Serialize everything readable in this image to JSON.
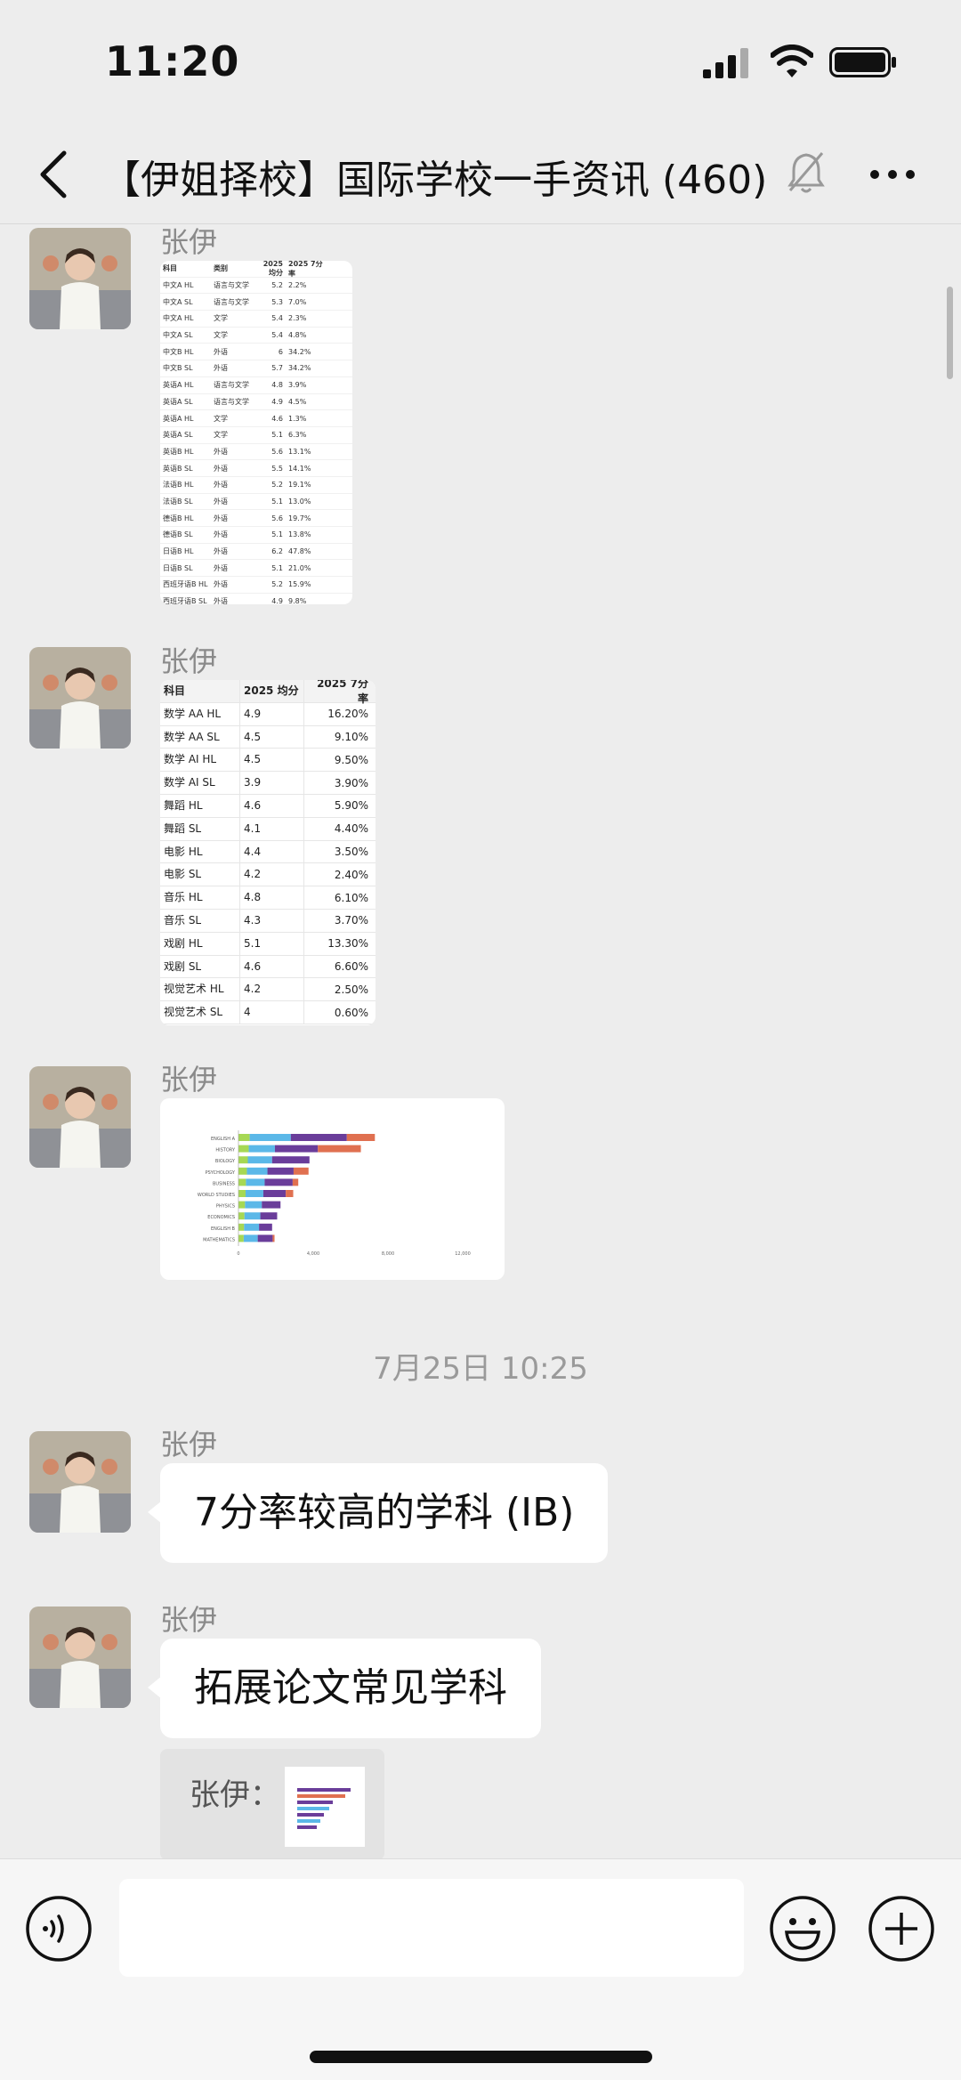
{
  "status": {
    "time": "11:20"
  },
  "nav": {
    "title": "【伊姐择校】国际学校一手资讯 (460)"
  },
  "messages": [
    {
      "sender": "张伊",
      "type": "image_table"
    },
    {
      "sender": "张伊",
      "type": "image_table"
    },
    {
      "sender": "张伊",
      "type": "image_chart"
    }
  ],
  "table1": {
    "headers": [
      "科目",
      "类别",
      "2025 均分",
      "2025 7分率"
    ],
    "rows": [
      [
        "中文A HL",
        "语言与文学",
        "5.2",
        "2.2%"
      ],
      [
        "中文A SL",
        "语言与文学",
        "5.3",
        "7.0%"
      ],
      [
        "中文A HL",
        "文学",
        "5.4",
        "2.3%"
      ],
      [
        "中文A SL",
        "文学",
        "5.4",
        "4.8%"
      ],
      [
        "中文B HL",
        "外语",
        "6",
        "34.2%"
      ],
      [
        "中文B SL",
        "外语",
        "5.7",
        "34.2%"
      ],
      [
        "英语A HL",
        "语言与文学",
        "4.8",
        "3.9%"
      ],
      [
        "英语A SL",
        "语言与文学",
        "4.9",
        "4.5%"
      ],
      [
        "英语A HL",
        "文学",
        "4.6",
        "1.3%"
      ],
      [
        "英语A SL",
        "文学",
        "5.1",
        "6.3%"
      ],
      [
        "英语B HL",
        "外语",
        "5.6",
        "13.1%"
      ],
      [
        "英语B SL",
        "外语",
        "5.5",
        "14.1%"
      ],
      [
        "法语B HL",
        "外语",
        "5.2",
        "19.1%"
      ],
      [
        "法语B SL",
        "外语",
        "5.1",
        "13.0%"
      ],
      [
        "德语B HL",
        "外语",
        "5.6",
        "19.7%"
      ],
      [
        "德语B SL",
        "外语",
        "5.1",
        "13.8%"
      ],
      [
        "日语B HL",
        "外语",
        "6.2",
        "47.8%"
      ],
      [
        "日语B SL",
        "外语",
        "5.1",
        "21.0%"
      ],
      [
        "西班牙语B HL",
        "外语",
        "5.2",
        "15.9%"
      ],
      [
        "西班牙语B SL",
        "外语",
        "4.9",
        "9.8%"
      ]
    ]
  },
  "table2": {
    "headers": [
      "科目",
      "2025 均分",
      "2025 7分率"
    ],
    "rows": [
      [
        "数学 AA HL",
        "4.9",
        "16.20%"
      ],
      [
        "数学 AA SL",
        "4.5",
        "9.10%"
      ],
      [
        "数学 AI HL",
        "4.5",
        "9.50%"
      ],
      [
        "数学 AI SL",
        "3.9",
        "3.90%"
      ],
      [
        "舞蹈 HL",
        "4.6",
        "5.90%"
      ],
      [
        "舞蹈 SL",
        "4.1",
        "4.40%"
      ],
      [
        "电影 HL",
        "4.4",
        "3.50%"
      ],
      [
        "电影 SL",
        "4.2",
        "2.40%"
      ],
      [
        "音乐 HL",
        "4.8",
        "6.10%"
      ],
      [
        "音乐 SL",
        "4.3",
        "3.70%"
      ],
      [
        "戏剧 HL",
        "5.1",
        "13.30%"
      ],
      [
        "戏剧 SL",
        "4.6",
        "6.60%"
      ],
      [
        "视觉艺术 HL",
        "4.2",
        "2.50%"
      ],
      [
        "视觉艺术 SL",
        "4",
        "0.60%"
      ]
    ]
  },
  "chart_data": {
    "type": "bar",
    "orientation": "horizontal",
    "stacked": true,
    "categories": [
      "ENGLISH A",
      "HISTORY",
      "BIOLOGY",
      "PSYCHOLOGY",
      "BUSINESS",
      "WORLD STUDIES",
      "PHYSICS",
      "ECONOMICS",
      "ENGLISH B",
      "MATHEMATICS"
    ],
    "series": [
      {
        "color": "#a6d854",
        "values": [
          600,
          550,
          500,
          450,
          400,
          380,
          350,
          320,
          300,
          280
        ]
      },
      {
        "color": "#5bb8e8",
        "values": [
          2200,
          1400,
          1300,
          1100,
          1000,
          950,
          900,
          850,
          800,
          750
        ]
      },
      {
        "color": "#6a3d9a",
        "values": [
          3000,
          2300,
          2000,
          1400,
          1500,
          1200,
          1000,
          900,
          700,
          800
        ]
      },
      {
        "color": "#e07050",
        "values": [
          1500,
          2300,
          0,
          800,
          300,
          400,
          0,
          0,
          0,
          100
        ]
      }
    ],
    "xlim": [
      0,
      12000
    ],
    "xticks": [
      "0",
      "4,000",
      "8,000",
      "12,000"
    ]
  },
  "timestamp": "7月25日 10:25",
  "text_messages": [
    {
      "sender": "张伊",
      "text": "7分率较高的学科 (IB)"
    },
    {
      "sender": "张伊",
      "text": "拓展论文常见学科"
    }
  ],
  "quote": {
    "label": "张伊："
  },
  "input": {
    "placeholder": ""
  }
}
